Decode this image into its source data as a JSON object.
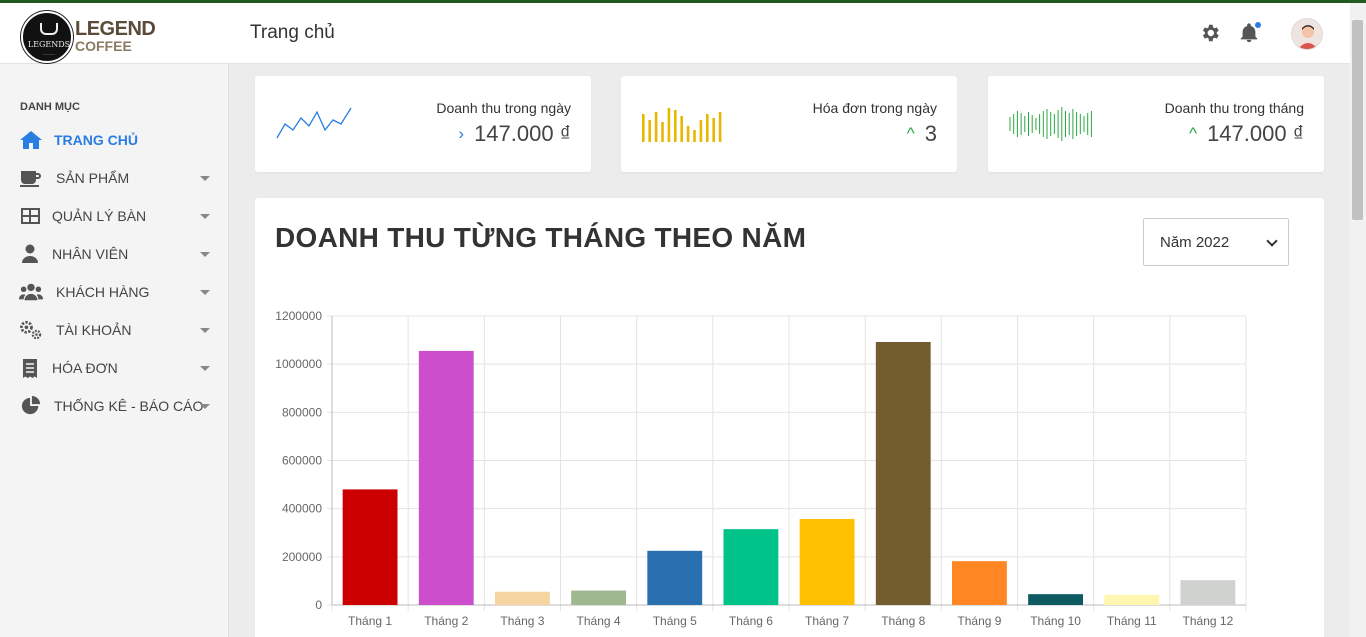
{
  "header": {
    "logo_name": "LEGEND",
    "logo_sub": "COFFEE",
    "logo_circle_text": "LEGENDS",
    "page_title": "Trang chủ"
  },
  "sidebar": {
    "heading": "DANH MỤC",
    "items": [
      {
        "label": "TRANG CHỦ",
        "icon": "home-icon",
        "active": true
      },
      {
        "label": "SẢN PHẨM",
        "icon": "coffee-cup-icon"
      },
      {
        "label": "QUẢN LÝ BÀN",
        "icon": "table-grid-icon"
      },
      {
        "label": "NHÂN VIÊN",
        "icon": "user-icon"
      },
      {
        "label": "KHÁCH HÀNG",
        "icon": "users-icon"
      },
      {
        "label": "TÀI KHOẢN",
        "icon": "gears-icon"
      },
      {
        "label": "HÓA ĐƠN",
        "icon": "receipt-icon"
      },
      {
        "label": "THỐNG KÊ - BÁO CÁO",
        "icon": "pie-chart-icon"
      }
    ]
  },
  "cards": [
    {
      "title": "Doanh thu trong ngày",
      "value": "147.000 ₫",
      "arrow": "›",
      "arrow_color": "#2a7de1",
      "spark_color": "#2a7de1"
    },
    {
      "title": "Hóa đơn trong ngày",
      "value": "3",
      "arrow": "^",
      "arrow_color": "#28a745",
      "spark_color": "#e6b800"
    },
    {
      "title": "Doanh thu trong tháng",
      "value": "147.000 ₫",
      "arrow": "^",
      "arrow_color": "#28a745",
      "spark_color": "#28a745"
    }
  ],
  "panel": {
    "title": "DOANH THU TỪNG THÁNG THEO NĂM",
    "year_selected": "Năm 2022"
  },
  "chart_data": {
    "type": "bar",
    "categories": [
      "Tháng 1",
      "Tháng 2",
      "Tháng 3",
      "Tháng 4",
      "Tháng 5",
      "Tháng 6",
      "Tháng 7",
      "Tháng 8",
      "Tháng 9",
      "Tháng 10",
      "Tháng 11",
      "Tháng 12"
    ],
    "values": [
      480000,
      1055000,
      55000,
      60000,
      225000,
      315000,
      357000,
      1092000,
      182000,
      45000,
      42000,
      103000
    ],
    "colors": [
      "#cc0000",
      "#cc4ecc",
      "#f5d4a0",
      "#9fb88f",
      "#2a6fb0",
      "#00c389",
      "#ffc000",
      "#735c2e",
      "#ff8623",
      "#0e5a63",
      "#fff7b0",
      "#d0d2cf"
    ],
    "ylim": [
      0,
      1200000
    ],
    "yticks": [
      "0",
      "200000",
      "400000",
      "600000",
      "800000",
      "1000000",
      "1200000"
    ],
    "grid": true
  }
}
